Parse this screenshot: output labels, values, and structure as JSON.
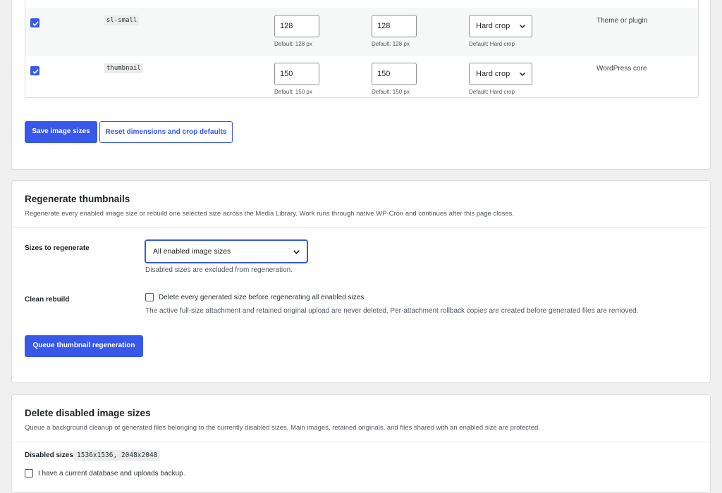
{
  "image_sizes": {
    "rows": [
      {
        "name": "sl-small",
        "checked": true,
        "width": "128",
        "height": "128",
        "crop": "Hard crop",
        "default_width": "Default: 128 px",
        "default_height": "Default: 128 px",
        "default_crop": "Default: Hard crop",
        "source": "Theme or plugin"
      },
      {
        "name": "thumbnail",
        "checked": true,
        "width": "150",
        "height": "150",
        "crop": "Hard crop",
        "default_width": "Default: 150 px",
        "default_height": "Default: 150 px",
        "default_crop": "Default: Hard crop",
        "source": "WordPress core"
      }
    ],
    "save_label": "Save image sizes",
    "reset_label": "Reset dimensions and crop defaults"
  },
  "regenerate": {
    "title": "Regenerate thumbnails",
    "description": "Regenerate every enabled image size or rebuild one selected size across the Media Library. Work runs through native WP-Cron and continues after this page closes.",
    "sizes_label": "Sizes to regenerate",
    "sizes_selected": "All enabled image sizes",
    "sizes_help": "Disabled sizes are excluded from regeneration.",
    "clean_label": "Clean rebuild",
    "clean_checkbox_label": "Delete every generated size before regenerating all enabled sizes",
    "clean_help": "The active full-size attachment and retained original upload are never deleted. Per-attachment rollback copies are created before generated files are removed.",
    "queue_label": "Queue thumbnail regeneration"
  },
  "delete_disabled": {
    "title": "Delete disabled image sizes",
    "description": "Queue a background cleanup of generated files belonging to the currently disabled sizes. Main images, retained originals, and files shared with an enabled size are protected.",
    "disabled_label": "Disabled sizes:",
    "disabled_values": "1536x1536, 2048x2048",
    "backup_label": "I have a current database and uploads backup."
  },
  "colors": {
    "accent": "#3858e9",
    "background": "#f0f0f1",
    "card": "#ffffff",
    "border": "#dcdcde"
  },
  "icons": {
    "checkbox": "checkmark-icon",
    "dropdown": "chevron-down-icon"
  }
}
